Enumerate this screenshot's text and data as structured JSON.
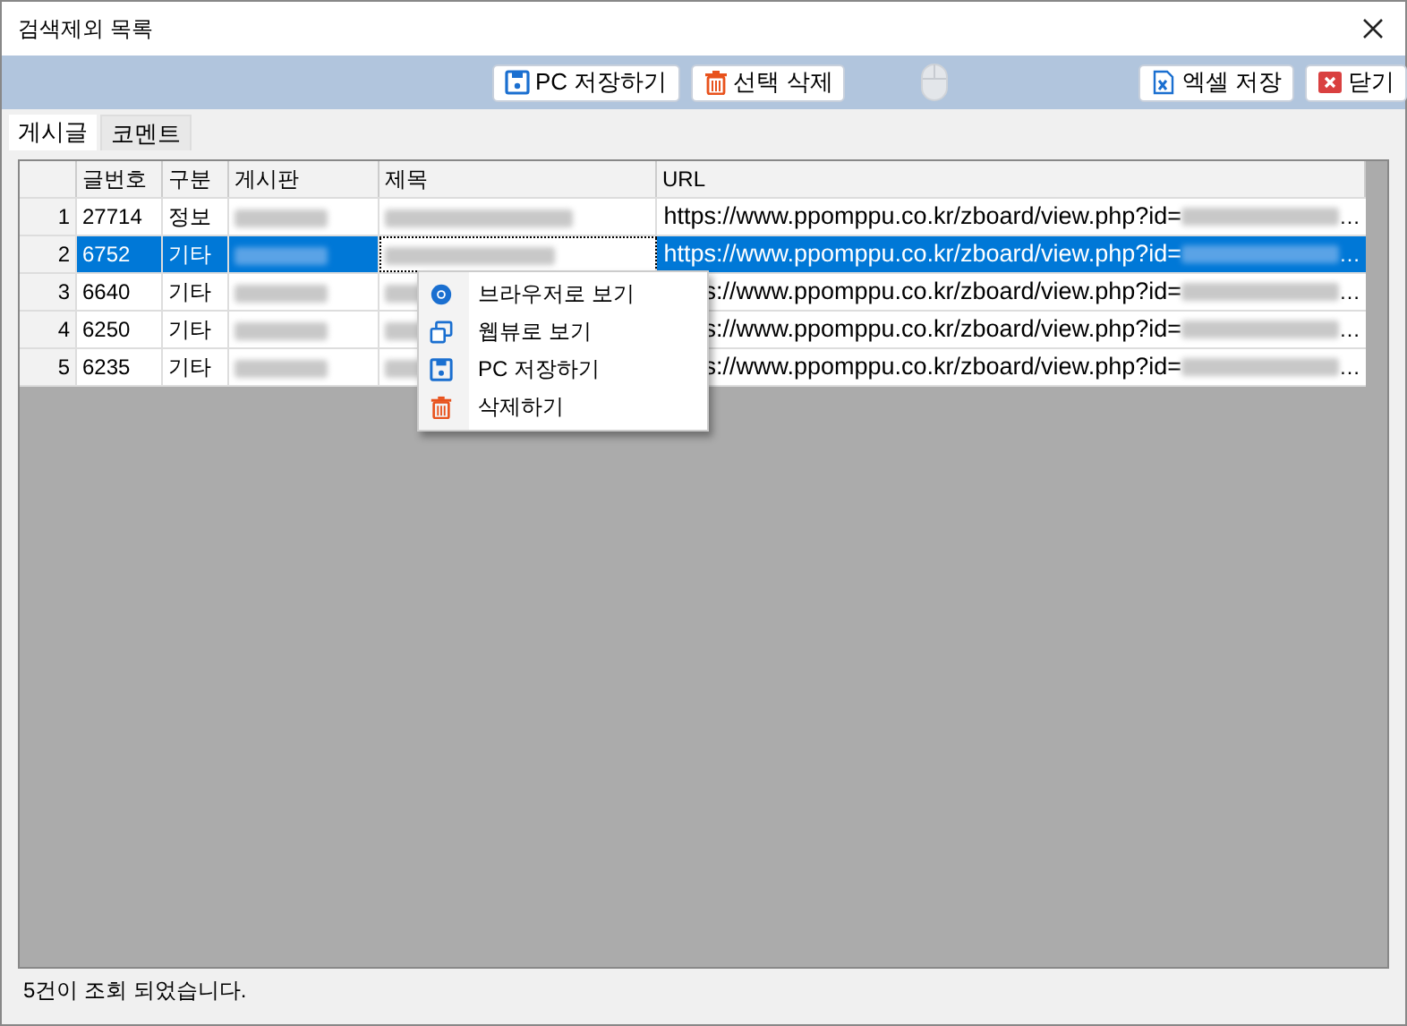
{
  "window": {
    "title": "검색제외 목록"
  },
  "toolbar": {
    "buttons": [
      {
        "label": "PC 저장하기",
        "kind": "save"
      },
      {
        "label": "선택 삭제",
        "kind": "delete"
      },
      {
        "kind": "mouse"
      },
      {
        "label": "엑셀 저장",
        "kind": "excel"
      },
      {
        "label": "닫기",
        "kind": "close"
      }
    ]
  },
  "tabs": [
    {
      "label": "게시글",
      "selected": true
    },
    {
      "label": "코멘트",
      "selected": false
    }
  ],
  "table": {
    "columns": [
      "글번호",
      "구분",
      "게시판",
      "제목",
      "URL"
    ],
    "rows": [
      {
        "index": "1",
        "number": "27714",
        "category": "정보",
        "url": "https://www.ppomppu.co.kr/zboard/view.php?id=",
        "url_tail": "…",
        "selected": false
      },
      {
        "index": "2",
        "number": "6752",
        "category": "기타",
        "url": "https://www.ppomppu.co.kr/zboard/view.php?id=",
        "url_tail": "…",
        "selected": true
      },
      {
        "index": "3",
        "number": "6640",
        "category": "기타",
        "url": "s://www.ppomppu.co.kr/zboard/view.php?id=",
        "url_tail": "…",
        "selected": false
      },
      {
        "index": "4",
        "number": "6250",
        "category": "기타",
        "url": "s://www.ppomppu.co.kr/zboard/view.php?id=",
        "url_tail": "…",
        "selected": false
      },
      {
        "index": "5",
        "number": "6235",
        "category": "기타",
        "url": "s://www.ppomppu.co.kr/zboard/view.php?id=",
        "url_tail": "…",
        "selected": false
      }
    ]
  },
  "context_menu": {
    "items": [
      {
        "label": "브라우저로 보기",
        "kind": "browser"
      },
      {
        "label": "웹뷰로 보기",
        "kind": "webview"
      },
      {
        "label": "PC 저장하기",
        "kind": "save"
      },
      {
        "label": "삭제하기",
        "kind": "delete"
      }
    ]
  },
  "status_bar": {
    "text": "5건이 조회 되었습니다."
  }
}
